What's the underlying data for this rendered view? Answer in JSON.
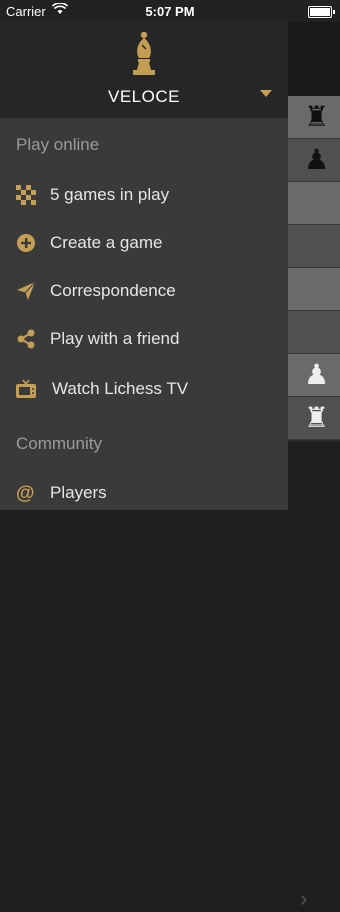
{
  "status_bar": {
    "carrier": "Carrier",
    "time": "5:07 PM"
  },
  "drawer": {
    "username": "VELOCE",
    "sections": {
      "play_online": "Play online",
      "community": "Community"
    },
    "items": [
      {
        "label": "5 games in play",
        "icon": "checkerboard-icon"
      },
      {
        "label": "Create a game",
        "icon": "plus-circle-icon"
      },
      {
        "label": "Correspondence",
        "icon": "paper-plane-icon"
      },
      {
        "label": "Play with a friend",
        "icon": "share-icon"
      },
      {
        "label": "Watch Lichess TV",
        "icon": "tv-icon"
      },
      {
        "label": "Players",
        "icon": "at-icon"
      }
    ]
  },
  "colors": {
    "accent": "#c59e56",
    "drawer_bg": "#3a3a3a",
    "header_bg": "#262626"
  }
}
